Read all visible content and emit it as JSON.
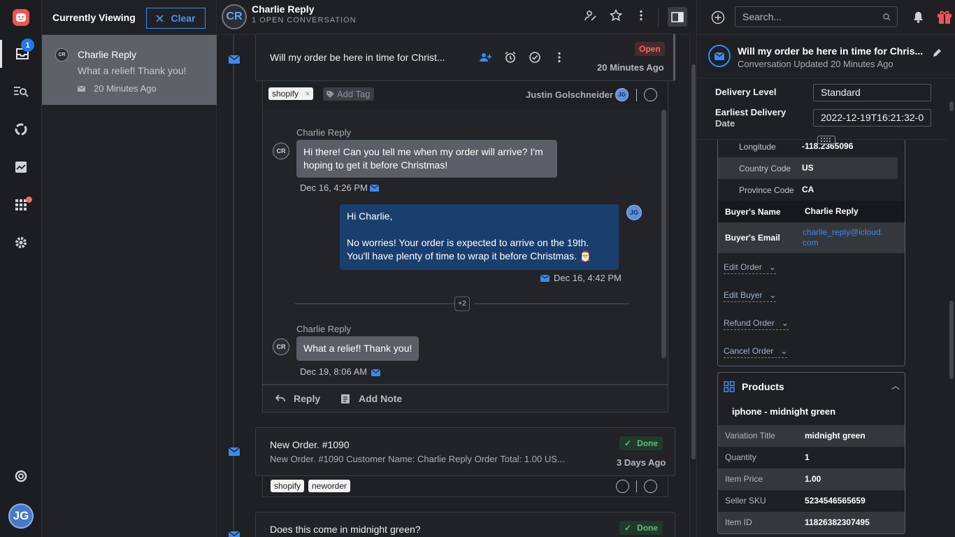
{
  "rail": {
    "inbox_badge": "1",
    "user_initials": "JG"
  },
  "viewing": {
    "title": "Currently Viewing",
    "clear_label": "Clear",
    "conversation": {
      "initials": "CR",
      "name": "Charlie Reply",
      "preview": "What a relief! Thank you!",
      "time": "20 Minutes Ago"
    }
  },
  "header": {
    "initials": "CR",
    "name": "Charlie Reply",
    "subtitle": "1 OPEN CONVERSATION"
  },
  "conversation": {
    "title": "Will my order be here in time for Christ...",
    "status": "Open",
    "time": "20 Minutes Ago",
    "tag": "shopify",
    "add_tag_placeholder": "Add Tag",
    "assignee": "Justin Golschneider",
    "assignee_initials": "JG",
    "messages": [
      {
        "sender": "Charlie Reply",
        "initials": "CR",
        "lines": [
          "Hi there! Can you tell me when my order will arrive? I'm",
          "hoping to get it before Christmas!"
        ],
        "time": "Dec 16, 4:26 PM"
      },
      {
        "initials": "JG",
        "lines": [
          "Hi Charlie,",
          "",
          "No worries! Your order is expected to arrive on the 19th.",
          "You'll have plenty of time to wrap it before Christmas. 🎅"
        ],
        "time": "Dec 16, 4:42 PM"
      },
      {
        "sender": "Charlie Reply",
        "initials": "CR",
        "lines": [
          "What a relief! Thank you!"
        ],
        "time": "Dec 19, 8:06 AM"
      }
    ],
    "collapsed_count": "+2",
    "reply_label": "Reply",
    "note_label": "Add Note"
  },
  "conversation2": {
    "title": "New Order. #1090",
    "preview": "New Order. #1090 Customer Name: Charlie Reply Order Total: 1.00 US...",
    "status": "Done",
    "time": "3 Days Ago",
    "tags": [
      "shopify",
      "neworder"
    ]
  },
  "conversation3": {
    "title": "Does this come in midnight green?",
    "status": "Done"
  },
  "right": {
    "search_placeholder": "Search...",
    "summary_title": "Will my order be here in time for Chris...",
    "summary_sub": "Conversation Updated 20 Minutes Ago",
    "delivery_level_label": "Delivery Level",
    "delivery_level_value": "Standard",
    "earliest_delivery_label_1": "Earliest Delivery",
    "earliest_delivery_label_2": "Date",
    "earliest_delivery_value": "2022-12-19T16:21:32-0",
    "order_rows": [
      {
        "k": "Longitude",
        "v": "-118.2365096"
      },
      {
        "k": "Country Code",
        "v": "US"
      },
      {
        "k": "Province Code",
        "v": "CA"
      }
    ],
    "buyer_name_label": "Buyer's Name",
    "buyer_name": "Charlie Reply",
    "buyer_email_label": "Buyer's Email",
    "buyer_email_1": "charlie_reply@icloud.",
    "buyer_email_2": "com",
    "actions": [
      "Edit Order",
      "Edit Buyer",
      "Refund Order",
      "Cancel Order"
    ],
    "products_title": "Products",
    "product_name": "iphone - midnight green",
    "product_rows": [
      {
        "k": "Variation Title",
        "v": "midnight green"
      },
      {
        "k": "Quantity",
        "v": "1"
      },
      {
        "k": "Item Price",
        "v": "1.00"
      },
      {
        "k": "Seller SKU",
        "v": "5234546565659"
      },
      {
        "k": "Item ID",
        "v": "11826382307495"
      }
    ]
  },
  "colors": {
    "accent": "#3b8af0",
    "open_status": "#f06b6b",
    "done_status": "#56c27a",
    "outgoing_bubble": "#1a3f6e"
  }
}
